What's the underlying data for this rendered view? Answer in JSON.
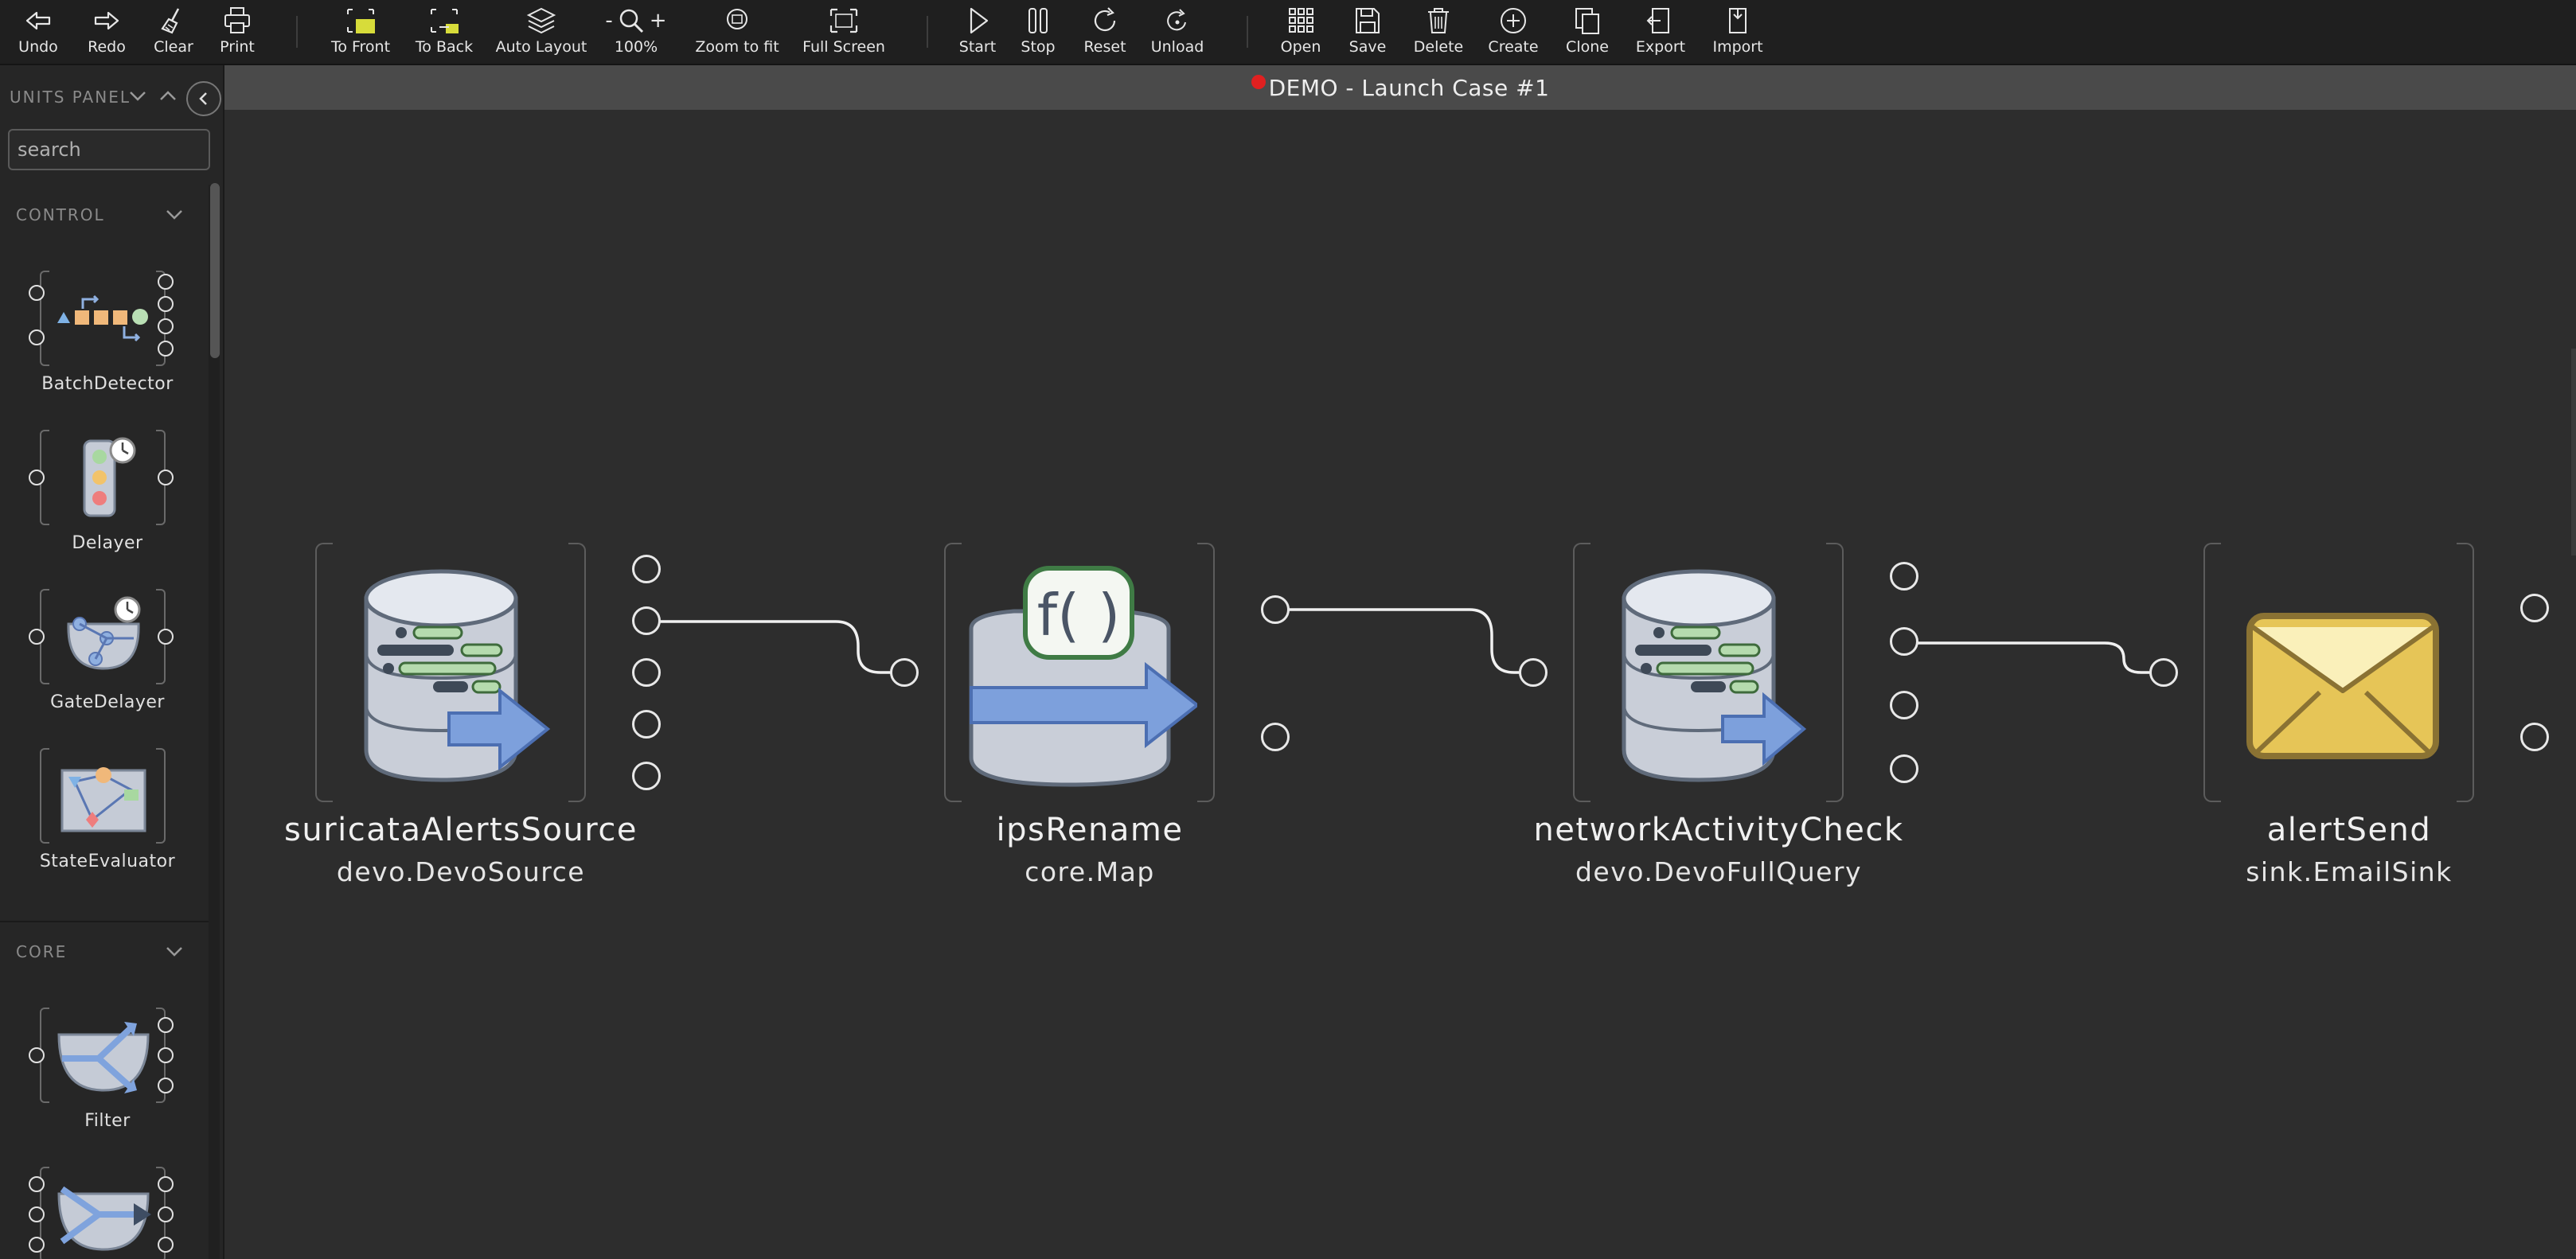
{
  "toolbar": {
    "undo": "Undo",
    "redo": "Redo",
    "clear": "Clear",
    "print": "Print",
    "to_front": "To Front",
    "to_back": "To Back",
    "auto_layout": "Auto Layout",
    "zoom_minus": "-",
    "zoom_plus": "+",
    "zoom_pct": "100%",
    "zoom_fit": "Zoom to fit",
    "full_screen": "Full Screen",
    "start": "Start",
    "stop": "Stop",
    "reset": "Reset",
    "unload": "Unload",
    "open": "Open",
    "save": "Save",
    "delete": "Delete",
    "create": "Create",
    "clone": "Clone",
    "export": "Export",
    "import": "Import"
  },
  "title": {
    "text": "DEMO - Launch Case #1",
    "status_color": "#e02020"
  },
  "sidebar": {
    "header": "UNITS PANEL",
    "search_placeholder": "search",
    "sections": [
      {
        "name": "CONTROL",
        "units": [
          "BatchDetector",
          "Delayer",
          "GateDelayer",
          "StateEvaluator"
        ]
      },
      {
        "name": "CORE",
        "units": [
          "Filter",
          ""
        ]
      }
    ]
  },
  "flow": {
    "nodes": [
      {
        "title": "suricataAlertsSource",
        "type": "devo.DevoSource",
        "icon": "database-source-icon"
      },
      {
        "title": "ipsRename",
        "type": "core.Map",
        "icon": "map-function-icon"
      },
      {
        "title": "networkActivityCheck",
        "type": "devo.DevoFullQuery",
        "icon": "database-query-icon"
      },
      {
        "title": "alertSend",
        "type": "sink.EmailSink",
        "icon": "envelope-icon"
      }
    ],
    "connections": [
      {
        "from": "suricataAlertsSource",
        "to": "ipsRename"
      },
      {
        "from": "ipsRename",
        "to": "networkActivityCheck"
      },
      {
        "from": "networkActivityCheck",
        "to": "alertSend"
      }
    ]
  },
  "colors": {
    "toolbar_bg": "#1f1f1f",
    "canvas_bg": "#2d2d2d",
    "title_bar_bg": "#4a4a4a",
    "accent_blue": "#6f94d6",
    "envelope_yellow": "#e6c557"
  }
}
